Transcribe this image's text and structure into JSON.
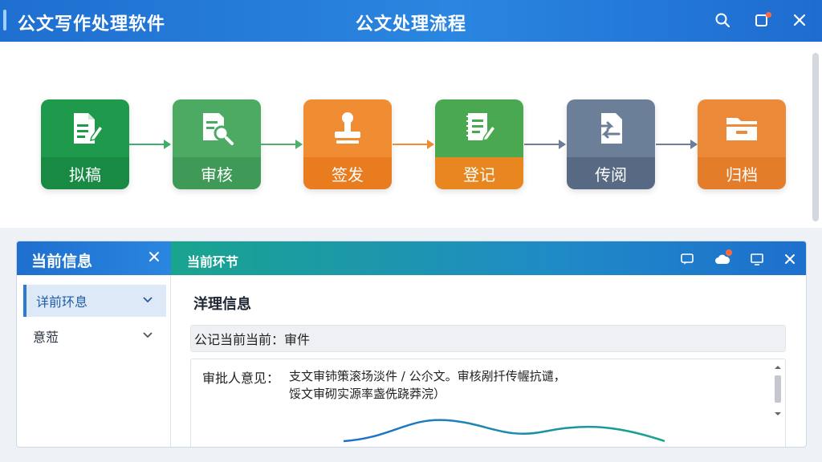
{
  "window": {
    "app_title": "公文写作处理软件",
    "page_title": "公文处理流程",
    "icons": [
      "search-icon",
      "notification-icon",
      "close-icon"
    ],
    "accent_color": "#1f6fd0"
  },
  "flow": {
    "steps": [
      {
        "label": "拟稿",
        "icon": "draft-document-icon",
        "color": "#1f9a4c",
        "label_color": "#188a43"
      },
      {
        "label": "审核",
        "icon": "review-search-icon",
        "color": "#4caa63",
        "label_color": "#3e9a56"
      },
      {
        "label": "签发",
        "icon": "stamp-icon",
        "color": "#f08c32",
        "label_color": "#e87c1f"
      },
      {
        "label": "登记",
        "icon": "register-document-icon",
        "color": "#4aa851",
        "label_color": "#e8861f"
      },
      {
        "label": "传阅",
        "icon": "circulate-document-icon",
        "color": "#6c7f99",
        "label_color": "#586a83"
      },
      {
        "label": "归档",
        "icon": "archive-folder-icon",
        "color": "#ec8a3a",
        "label_color": "#e47d29"
      }
    ]
  },
  "panel": {
    "left_title": "当前信息",
    "right_title": "当前环节",
    "sidebar": {
      "items": [
        {
          "label": "详前环息",
          "active": true
        },
        {
          "label": "意蒞",
          "active": false
        }
      ]
    },
    "content": {
      "section_title": "洋理信息",
      "status_row": "公记当前当前：审件",
      "opinion_label": "审批人意见：",
      "opinion_lines": [
        "支文审铈策滚场淡件 / 公尒文。审核剐扦传幄抗谴，",
        "馁文审砌实源率盏侁跷莽浣）"
      ]
    }
  }
}
